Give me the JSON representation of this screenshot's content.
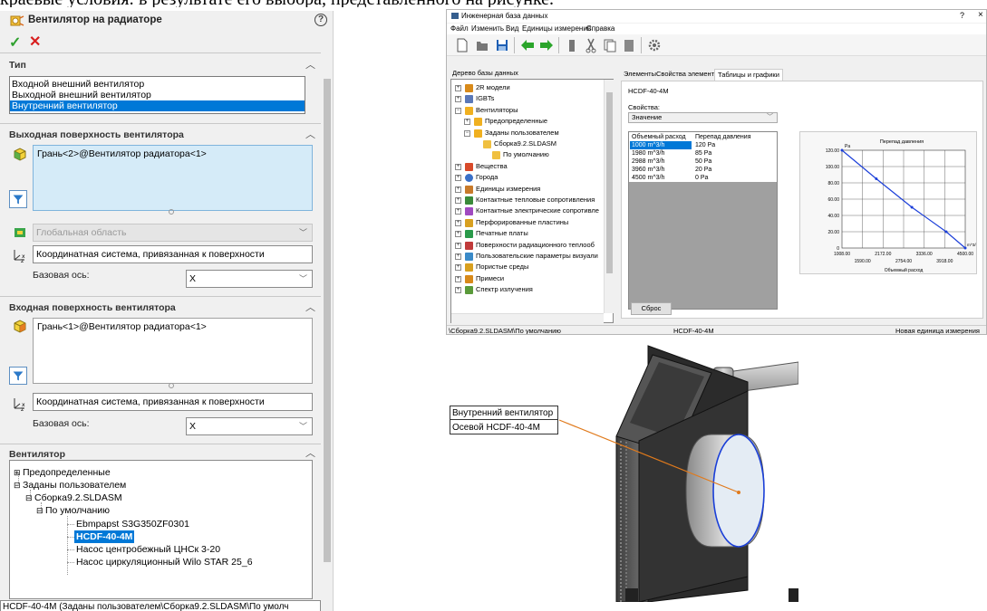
{
  "top_text": "краевые условия: в результате его выбора, представленного на рисунке.",
  "pm": {
    "title": "Вентилятор на радиаторе",
    "help": "?",
    "ok": "✓",
    "cancel": "✕",
    "type_section": {
      "title": "Тип",
      "items": [
        "Входной внешний вентилятор",
        "Выходной внешний вентилятор",
        "Внутренний вентилятор"
      ],
      "selected": 2
    },
    "outlet_section": {
      "title": "Выходная поверхность вентилятора",
      "face": "Грань<2>@Вентилятор радиатора<1>",
      "global_region": "Глобальная область",
      "coord_system": "Координатная система, привязанная к поверхности",
      "base_axis_label": "Базовая ось:",
      "base_axis_value": "X"
    },
    "inlet_section": {
      "title": "Входная поверхность вентилятора",
      "face": "Грань<1>@Вентилятор радиатора<1>",
      "coord_system": "Координатная система, привязанная к поверхности",
      "base_axis_label": "Базовая ось:",
      "base_axis_value": "X"
    },
    "fan_section": {
      "title": "Вентилятор",
      "tree": {
        "predefined": "Предопределенные",
        "user_defined": "Заданы пользователем",
        "assembly": "Сборка9.2.SLDASM",
        "default": "По умолчанию",
        "items": [
          "Ebmpapst S3G350ZF0301",
          "HCDF-40-4M",
          "Насос центробежный ЦНСк 3-20",
          "Насос циркуляционный Wilo STAR 25_6"
        ],
        "selected": 1
      },
      "bottom_value": "HCDF-40-4M (Заданы пользователем\\Сборка9.2.SLDASM\\По умолч"
    }
  },
  "edb": {
    "title": "Инженерная база данных",
    "help": "?",
    "close": "×",
    "menu": [
      "Файл",
      "Изменить",
      "Вид",
      "Единицы измерения",
      "Справка"
    ],
    "tree_label": "Дерево базы данных",
    "tree": [
      "2R модели",
      "IGBTs",
      "Вентиляторы",
      "Предопределенные",
      "Заданы пользователем",
      "Сборка9.2.SLDASM",
      "По умолчанию",
      "Вещества",
      "Города",
      "Единицы измерения",
      "Контактные тепловые сопротивления",
      "Контактные электрические сопротивле",
      "Перфорированные пластины",
      "Печатные платы",
      "Поверхности радиационного теплооб",
      "Пользовательские параметры визуали",
      "Пористые среды",
      "Примеси",
      "Спектр излучения"
    ],
    "tabs": [
      "Элементы",
      "Свойства элемента",
      "Таблицы и графики"
    ],
    "active_tab": 2,
    "item_name": "HCDF-40-4M",
    "props_label": "Свойства:",
    "props_value": "Значение",
    "grid_headers": [
      "Объемный расход",
      "Перепад давления"
    ],
    "grid_rows": [
      [
        "1000 m^3/h",
        "120 Pa"
      ],
      [
        "1980 m^3/h",
        "85 Pa"
      ],
      [
        "2988 m^3/h",
        "50 Pa"
      ],
      [
        "3960 m^3/h",
        "20 Pa"
      ],
      [
        "4500 m^3/h",
        "0 Pa"
      ]
    ],
    "reset_button": "Сброс",
    "status": [
      "\\Сборка9.2.SLDASM\\По умолчанию",
      "HCDF-40-4M",
      "Новая единица измерения"
    ]
  },
  "chart_data": {
    "type": "line",
    "title": "Перепад давления",
    "xlabel": "Объемный расход",
    "ylabel": "Pa",
    "x_unit": "m^3/h",
    "xlim": [
      1008,
      4500
    ],
    "ylim": [
      0,
      120
    ],
    "x_ticks_top": [
      "1008.00",
      "2172.00",
      "3336.00",
      "4500.00"
    ],
    "x_ticks_bottom": [
      "1590.00",
      "2754.00",
      "3918.00"
    ],
    "y_ticks": [
      "0",
      "20.00",
      "40.00",
      "60.00",
      "80.00",
      "100.00",
      "120.00"
    ],
    "series": [
      {
        "x": [
          1000,
          1980,
          2988,
          3960,
          4500
        ],
        "y": [
          120,
          85,
          50,
          20,
          0
        ]
      }
    ],
    "grid": true,
    "color": "#1c3fd9"
  },
  "callout": {
    "line1": "Внутренний вентилятор",
    "line2": "Осевой HCDF-40-4M"
  }
}
